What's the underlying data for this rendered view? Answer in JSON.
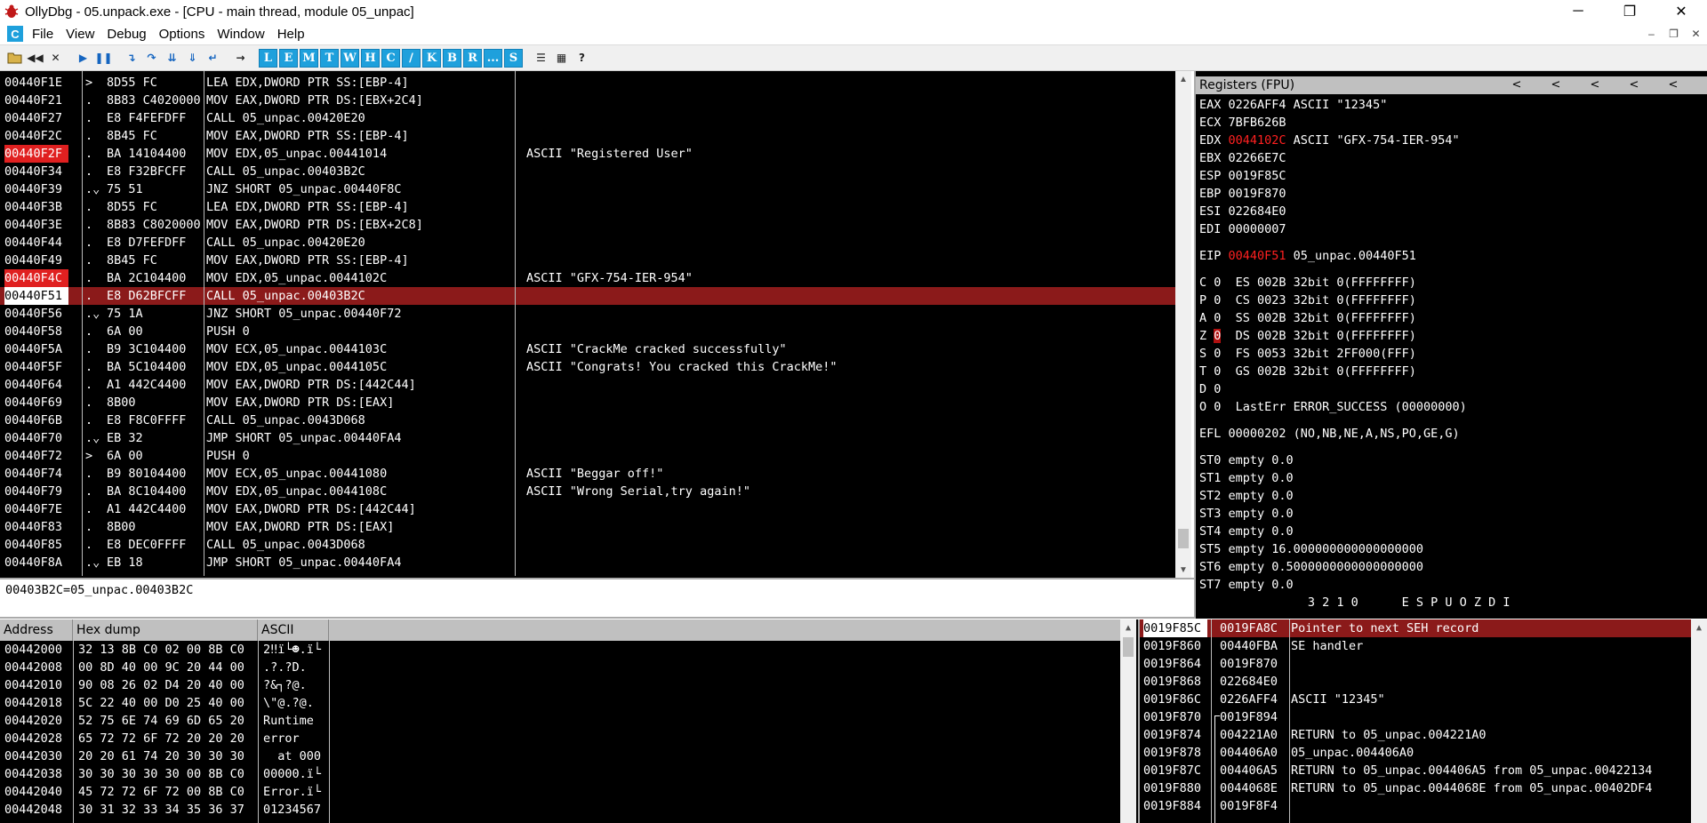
{
  "window": {
    "title": "OllyDbg - 05.unpack.exe - [CPU - main thread, module 05_unpac]",
    "minimize": "─",
    "maximize": "❐",
    "close": "✕"
  },
  "menu": {
    "items": [
      "File",
      "View",
      "Debug",
      "Options",
      "Window",
      "Help"
    ],
    "mdi_buttons": [
      "–",
      "❐",
      "✕"
    ]
  },
  "toolbar": {
    "letters": [
      "L",
      "E",
      "M",
      "T",
      "W",
      "H",
      "C",
      "/",
      "K",
      "B",
      "R",
      "...",
      "S"
    ]
  },
  "disasm": {
    "rows": [
      {
        "addr": "00440F1E",
        "mark": ">",
        "hex": "8D55 FC",
        "dis": "LEA EDX,DWORD PTR SS:[EBP-4]",
        "comment": ""
      },
      {
        "addr": "00440F21",
        "mark": ".",
        "hex": "8B83 C4020000",
        "dis": "MOV EAX,DWORD PTR DS:[EBX+2C4]",
        "comment": ""
      },
      {
        "addr": "00440F27",
        "mark": ".",
        "hex": "E8 F4FEFDFF",
        "dis": "CALL 05_unpac.00420E20",
        "comment": ""
      },
      {
        "addr": "00440F2C",
        "mark": ".",
        "hex": "8B45 FC",
        "dis": "MOV EAX,DWORD PTR SS:[EBP-4]",
        "comment": ""
      },
      {
        "addr": "00440F2F",
        "mark": ".",
        "hex": "BA 14104400",
        "dis": "MOV EDX,05_unpac.00441014",
        "comment": "ASCII \"Registered User\"",
        "bp": true
      },
      {
        "addr": "00440F34",
        "mark": ".",
        "hex": "E8 F32BFCFF",
        "dis": "CALL 05_unpac.00403B2C",
        "comment": ""
      },
      {
        "addr": "00440F39",
        "mark": ".⌄",
        "hex": "75 51",
        "dis": "JNZ SHORT 05_unpac.00440F8C",
        "comment": ""
      },
      {
        "addr": "00440F3B",
        "mark": ".",
        "hex": "8D55 FC",
        "dis": "LEA EDX,DWORD PTR SS:[EBP-4]",
        "comment": ""
      },
      {
        "addr": "00440F3E",
        "mark": ".",
        "hex": "8B83 C8020000",
        "dis": "MOV EAX,DWORD PTR DS:[EBX+2C8]",
        "comment": ""
      },
      {
        "addr": "00440F44",
        "mark": ".",
        "hex": "E8 D7FEFDFF",
        "dis": "CALL 05_unpac.00420E20",
        "comment": ""
      },
      {
        "addr": "00440F49",
        "mark": ".",
        "hex": "8B45 FC",
        "dis": "MOV EAX,DWORD PTR SS:[EBP-4]",
        "comment": ""
      },
      {
        "addr": "00440F4C",
        "mark": ".",
        "hex": "BA 2C104400",
        "dis": "MOV EDX,05_unpac.0044102C",
        "comment": "ASCII \"GFX-754-IER-954\"",
        "bp": true
      },
      {
        "addr": "00440F51",
        "mark": ".",
        "hex": "E8 D62BFCFF",
        "dis": "CALL 05_unpac.00403B2C",
        "comment": "",
        "cur": true
      },
      {
        "addr": "00440F56",
        "mark": ".⌄",
        "hex": "75 1A",
        "dis": "JNZ SHORT 05_unpac.00440F72",
        "comment": ""
      },
      {
        "addr": "00440F58",
        "mark": ".",
        "hex": "6A 00",
        "dis": "PUSH 0",
        "comment": ""
      },
      {
        "addr": "00440F5A",
        "mark": ".",
        "hex": "B9 3C104400",
        "dis": "MOV ECX,05_unpac.0044103C",
        "comment": "ASCII \"CrackMe cracked successfully\""
      },
      {
        "addr": "00440F5F",
        "mark": ".",
        "hex": "BA 5C104400",
        "dis": "MOV EDX,05_unpac.0044105C",
        "comment": "ASCII \"Congrats! You cracked this CrackMe!\""
      },
      {
        "addr": "00440F64",
        "mark": ".",
        "hex": "A1 442C4400",
        "dis": "MOV EAX,DWORD PTR DS:[442C44]",
        "comment": ""
      },
      {
        "addr": "00440F69",
        "mark": ".",
        "hex": "8B00",
        "dis": "MOV EAX,DWORD PTR DS:[EAX]",
        "comment": ""
      },
      {
        "addr": "00440F6B",
        "mark": ".",
        "hex": "E8 F8C0FFFF",
        "dis": "CALL 05_unpac.0043D068",
        "comment": ""
      },
      {
        "addr": "00440F70",
        "mark": ".⌄",
        "hex": "EB 32",
        "dis": "JMP SHORT 05_unpac.00440FA4",
        "comment": ""
      },
      {
        "addr": "00440F72",
        "mark": ">",
        "hex": "6A 00",
        "dis": "PUSH 0",
        "comment": ""
      },
      {
        "addr": "00440F74",
        "mark": ".",
        "hex": "B9 80104400",
        "dis": "MOV ECX,05_unpac.00441080",
        "comment": "ASCII \"Beggar off!\""
      },
      {
        "addr": "00440F79",
        "mark": ".",
        "hex": "BA 8C104400",
        "dis": "MOV EDX,05_unpac.0044108C",
        "comment": "ASCII \"Wrong Serial,try again!\""
      },
      {
        "addr": "00440F7E",
        "mark": ".",
        "hex": "A1 442C4400",
        "dis": "MOV EAX,DWORD PTR DS:[442C44]",
        "comment": ""
      },
      {
        "addr": "00440F83",
        "mark": ".",
        "hex": "8B00",
        "dis": "MOV EAX,DWORD PTR DS:[EAX]",
        "comment": ""
      },
      {
        "addr": "00440F85",
        "mark": ".",
        "hex": "E8 DEC0FFFF",
        "dis": "CALL 05_unpac.0043D068",
        "comment": ""
      },
      {
        "addr": "00440F8A",
        "mark": ".⌄",
        "hex": "EB 18",
        "dis": "JMP SHORT 05_unpac.00440FA4",
        "comment": ""
      }
    ]
  },
  "info_line": "00403B2C=05_unpac.00403B2C",
  "registers": {
    "header": "Registers (FPU)",
    "arrows": [
      "<",
      "<",
      "<",
      "<",
      "<"
    ],
    "eax": "EAX 0226AFF4 ASCII \"12345\"",
    "ecx": "ECX 7BFB626B",
    "edx_name": "EDX ",
    "edx_val": "0044102C",
    "edx_rest": " ASCII \"GFX-754-IER-954\"",
    "ebx": "EBX 02266E7C",
    "esp": "ESP 0019F85C",
    "ebp": "EBP 0019F870",
    "esi": "ESI 022684E0",
    "edi": "EDI 00000007",
    "eip_name": "EIP ",
    "eip_val": "00440F51",
    "eip_rest": " 05_unpac.00440F51",
    "flag_c": "C 0  ES 002B 32bit 0(FFFFFFFF)",
    "flag_p": "P 0  CS 0023 32bit 0(FFFFFFFF)",
    "flag_a": "A 0  SS 002B 32bit 0(FFFFFFFF)",
    "flag_z_name": "Z ",
    "flag_z_val": "0",
    "flag_z_rest": "  DS 002B 32bit 0(FFFFFFFF)",
    "flag_s": "S 0  FS 0053 32bit 2FF000(FFF)",
    "flag_t": "T 0  GS 002B 32bit 0(FFFFFFFF)",
    "flag_d": "D 0",
    "flag_o": "O 0  LastErr ERROR_SUCCESS (00000000)",
    "efl": "EFL 00000202 (NO,NB,NE,A,NS,PO,GE,G)",
    "st0": "ST0 empty 0.0",
    "st1": "ST1 empty 0.0",
    "st2": "ST2 empty 0.0",
    "st3": "ST3 empty 0.0",
    "st4": "ST4 empty 0.0",
    "st5": "ST5 empty 16.000000000000000000",
    "st6": "ST6 empty 0.5000000000000000000",
    "st7": "ST7 empty 0.0",
    "fpu_bits": "               3 2 1 0      E S P U O Z D I"
  },
  "dump": {
    "headers": [
      "Address",
      "Hex dump",
      "ASCII"
    ],
    "rows": [
      {
        "addr": "00442000",
        "hex": "32 13 8B C0 02 00 8B C0",
        "ascii": "2‼ï└☻.ï└"
      },
      {
        "addr": "00442008",
        "hex": "00 8D 40 00 9C 20 44 00",
        "ascii": ".?.?D."
      },
      {
        "addr": "00442010",
        "hex": "90 08 26 02 D4 20 40 00",
        "ascii": "?&┐?@."
      },
      {
        "addr": "00442018",
        "hex": "5C 22 40 00 D0 25 40 00",
        "ascii": "\\\"@.?@."
      },
      {
        "addr": "00442020",
        "hex": "52 75 6E 74 69 6D 65 20",
        "ascii": "Runtime "
      },
      {
        "addr": "00442028",
        "hex": "65 72 72 6F 72 20 20 20",
        "ascii": "error   "
      },
      {
        "addr": "00442030",
        "hex": "20 20 61 74 20 30 30 30",
        "ascii": "  at 000"
      },
      {
        "addr": "00442038",
        "hex": "30 30 30 30 30 00 8B C0",
        "ascii": "00000.ï└"
      },
      {
        "addr": "00442040",
        "hex": "45 72 72 6F 72 00 8B C0",
        "ascii": "Error.ï└"
      },
      {
        "addr": "00442048",
        "hex": "30 31 32 33 34 35 36 37",
        "ascii": "01234567"
      }
    ]
  },
  "stack": {
    "rows": [
      {
        "addr": "0019F85C",
        "val": "0019FA8C",
        "com": "Pointer to next SEH record",
        "cur": true
      },
      {
        "addr": "0019F860",
        "val": "00440FBA",
        "com": "SE handler"
      },
      {
        "addr": "0019F864",
        "val": "0019F870",
        "com": ""
      },
      {
        "addr": "0019F868",
        "val": "022684E0",
        "com": ""
      },
      {
        "addr": "0019F86C",
        "val": "0226AFF4",
        "com": "ASCII \"12345\""
      },
      {
        "addr": "0019F870",
        "val": "0019F894",
        "com": ""
      },
      {
        "addr": "0019F874",
        "val": "004221A0",
        "com": "RETURN to 05_unpac.004221A0"
      },
      {
        "addr": "0019F878",
        "val": "004406A0",
        "com": "05_unpac.004406A0"
      },
      {
        "addr": "0019F87C",
        "val": "004406A5",
        "com": "RETURN to 05_unpac.004406A5 from 05_unpac.00422134"
      },
      {
        "addr": "0019F880",
        "val": "0044068E",
        "com": "RETURN to 05_unpac.0044068E from 05_unpac.00402DF4"
      },
      {
        "addr": "0019F884",
        "val": "0019F8F4",
        "com": ""
      }
    ]
  }
}
